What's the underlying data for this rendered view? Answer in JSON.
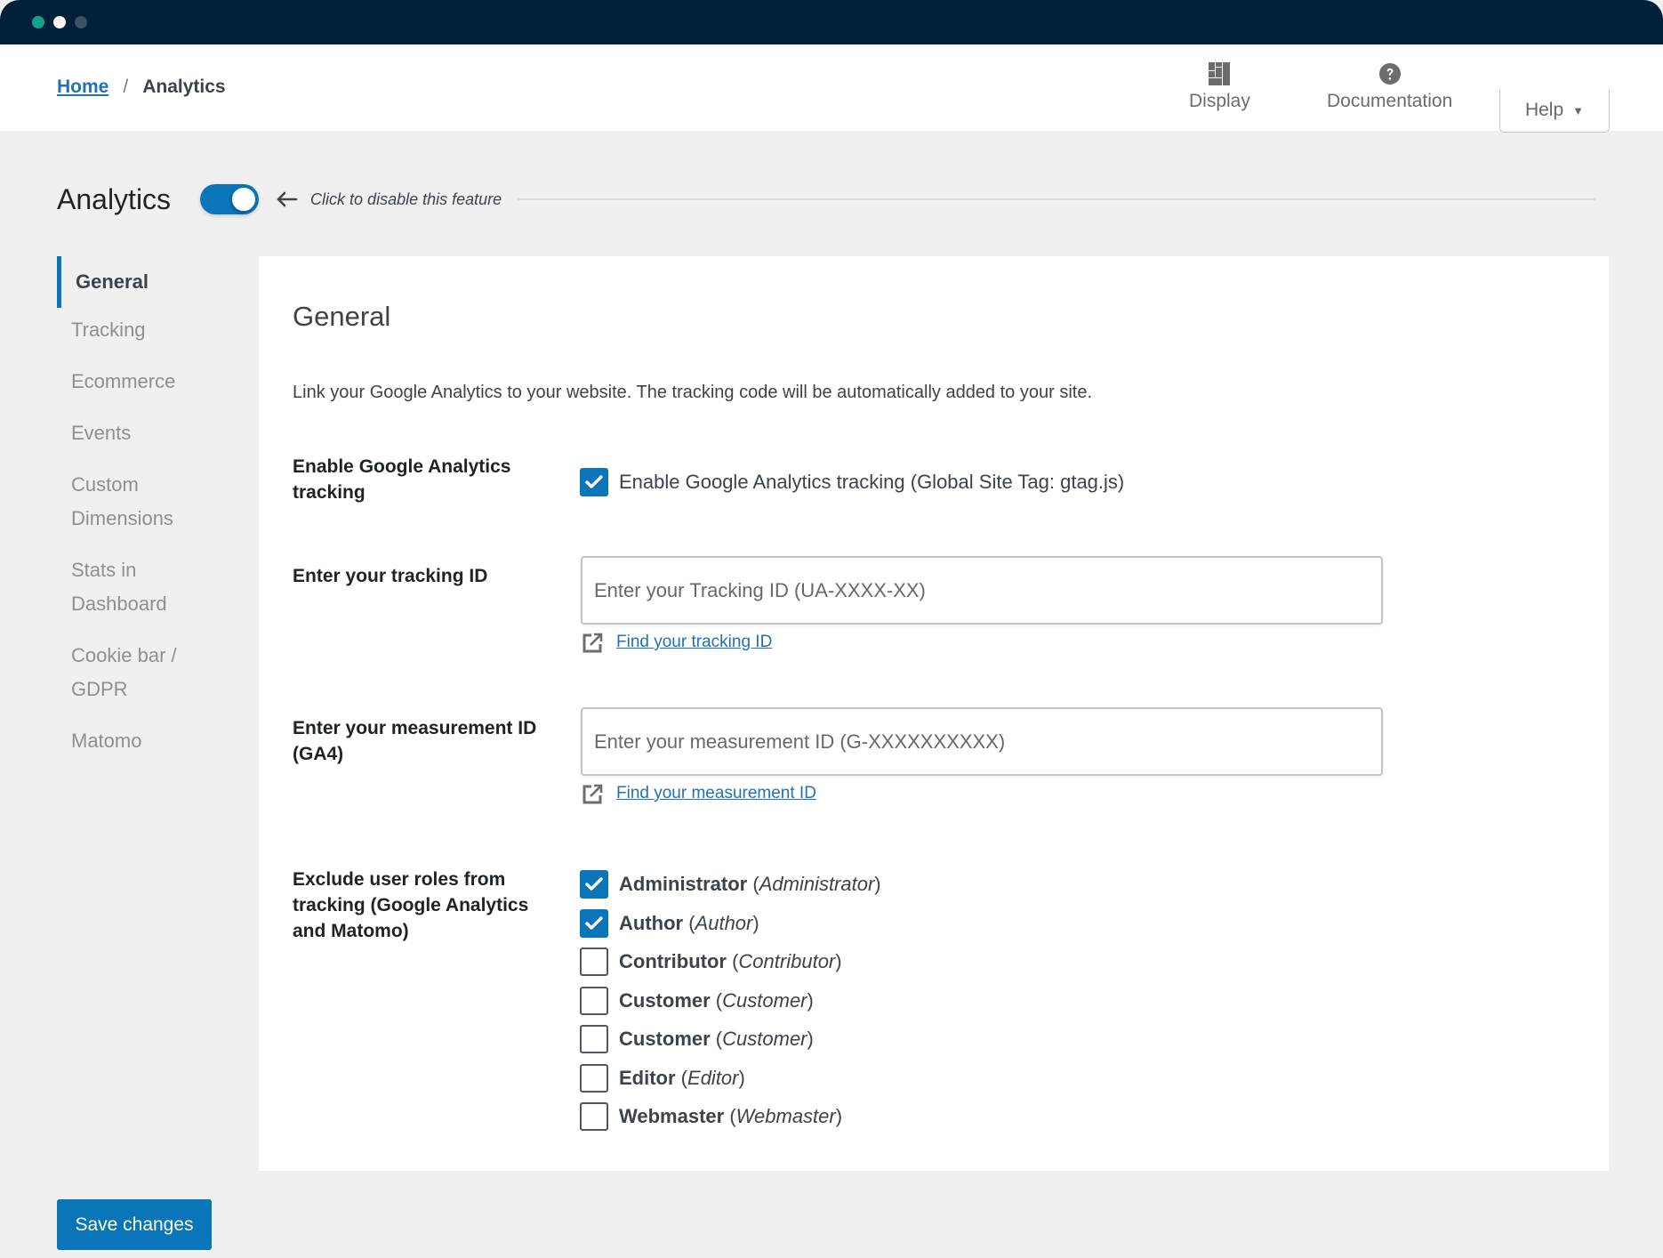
{
  "window": {
    "dots": [
      "#11a38f",
      "#fff3f3",
      "#3c5068"
    ]
  },
  "header": {
    "breadcrumb": {
      "home": "Home",
      "separator": "/",
      "current": "Analytics"
    },
    "links": [
      {
        "label": "Display",
        "icon": "layout-grid-icon"
      },
      {
        "label": "Documentation",
        "icon": "question-circle-icon"
      }
    ],
    "help": {
      "label": "Help",
      "caret": "▼"
    }
  },
  "feature": {
    "title": "Analytics",
    "enabled": true,
    "hint": "Click to disable this feature"
  },
  "sidebar": {
    "items": [
      {
        "label": "General",
        "active": true
      },
      {
        "label": "Tracking",
        "active": false
      },
      {
        "label": "Ecommerce",
        "active": false
      },
      {
        "label": "Events",
        "active": false
      },
      {
        "label": "Custom Dimensions",
        "active": false
      },
      {
        "label": "Stats in Dashboard",
        "active": false
      },
      {
        "label": "Cookie bar / GDPR",
        "active": false
      },
      {
        "label": "Matomo",
        "active": false
      }
    ]
  },
  "panel": {
    "title": "General",
    "description": "Link your Google Analytics to your website. The tracking code will be automatically added to your site.",
    "enable_ga": {
      "label": "Enable Google Analytics tracking",
      "checkbox_label": "Enable Google Analytics tracking (Global Site Tag: gtag.js)",
      "checked": true
    },
    "tracking_id": {
      "label": "Enter your tracking ID",
      "value": "",
      "placeholder": "Enter your Tracking ID (UA-XXXX-XX)",
      "link": "Find your tracking ID"
    },
    "measurement_id": {
      "label": "Enter your measurement ID (GA4)",
      "value": "",
      "placeholder": "Enter your measurement ID (G-XXXXXXXXXX)",
      "link": "Find your measurement ID"
    },
    "exclude_roles": {
      "label": "Exclude user roles from tracking (Google Analytics and Matomo)",
      "roles": [
        {
          "name": "Administrator",
          "slug": "Administrator",
          "checked": true
        },
        {
          "name": "Author",
          "slug": "Author",
          "checked": true
        },
        {
          "name": "Contributor",
          "slug": "Contributor",
          "checked": false
        },
        {
          "name": "Customer",
          "slug": "Customer",
          "checked": false
        },
        {
          "name": "Customer",
          "slug": "Customer",
          "checked": false
        },
        {
          "name": "Editor",
          "slug": "Editor",
          "checked": false
        },
        {
          "name": "Webmaster",
          "slug": "Webmaster",
          "checked": false
        }
      ]
    }
  },
  "footer": {
    "save_label": "Save changes"
  },
  "colors": {
    "accent": "#0a75b9",
    "link": "#2271b1",
    "titlebar": "#00203a",
    "background": "#f0f0f1",
    "panel": "#ffffff"
  }
}
